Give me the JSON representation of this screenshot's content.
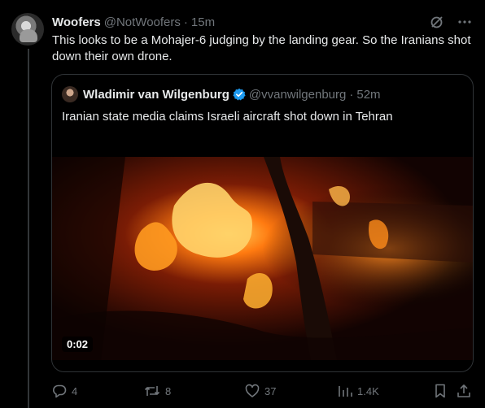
{
  "post": {
    "author_name": "Woofers",
    "author_handle": "@NotWoofers",
    "separator": "·",
    "time": "15m",
    "text": "This looks to be a Mohajer-6 judging by the landing gear. So the Iranians shot down their own drone."
  },
  "quoted": {
    "author_name": "Wladimir van Wilgenburg",
    "author_handle": "@vvanwilgenburg",
    "separator": "·",
    "time": "52m",
    "text": "Iranian state media claims Israeli aircraft shot down in Tehran",
    "video_duration": "0:02"
  },
  "actions": {
    "replies": "4",
    "reposts": "8",
    "likes": "37",
    "views": "1.4K"
  },
  "icons": {
    "header": [
      "grok-icon",
      "more-icon"
    ],
    "verified": "verified-badge-icon",
    "actions": [
      "reply-icon",
      "repost-icon",
      "like-icon",
      "views-icon",
      "bookmark-icon",
      "share-icon"
    ]
  },
  "colors": {
    "background": "#000000",
    "text": "#e7e9ea",
    "secondary": "#71767b",
    "border": "#2f3336",
    "verified": "#1d9bf0"
  }
}
